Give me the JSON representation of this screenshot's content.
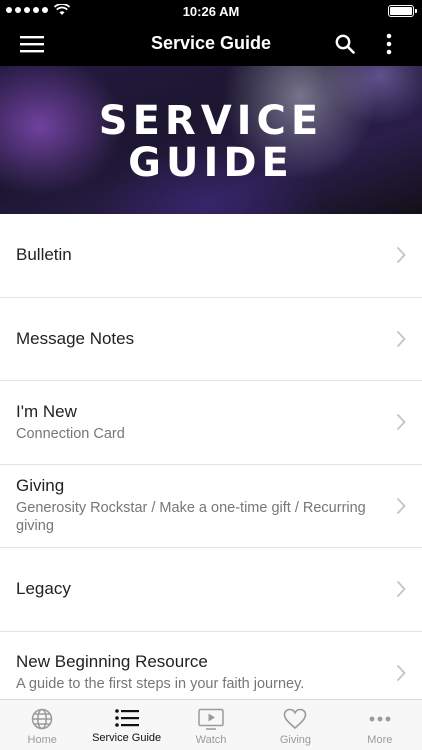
{
  "status": {
    "time": "10:26 AM"
  },
  "nav": {
    "title": "Service Guide"
  },
  "hero": {
    "line1": "SERVICE",
    "line2": "GUIDE"
  },
  "list": [
    {
      "title": "Bulletin",
      "subtitle": ""
    },
    {
      "title": "Message Notes",
      "subtitle": ""
    },
    {
      "title": "I'm New",
      "subtitle": "Connection Card"
    },
    {
      "title": "Giving",
      "subtitle": "Generosity Rockstar / Make a one-time gift / Recurring giving"
    },
    {
      "title": "Legacy",
      "subtitle": ""
    },
    {
      "title": "New Beginning Resource",
      "subtitle": "A guide to the first steps in your faith journey."
    }
  ],
  "tabs": [
    {
      "label": "Home",
      "icon": "globe-icon"
    },
    {
      "label": "Service Guide",
      "icon": "list-icon"
    },
    {
      "label": "Watch",
      "icon": "play-icon"
    },
    {
      "label": "Giving",
      "icon": "heart-icon"
    },
    {
      "label": "More",
      "icon": "more-dots-icon"
    }
  ],
  "colors": {
    "header": "#000000",
    "active_tab": "#111111",
    "inactive_tab": "#9a9a9a"
  }
}
